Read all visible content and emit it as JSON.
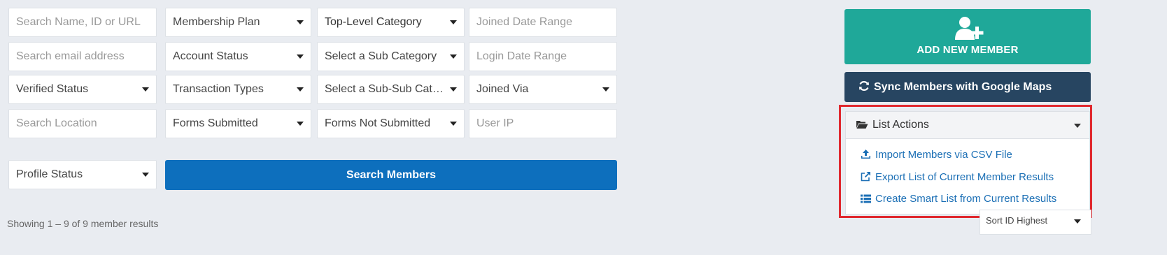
{
  "filters": {
    "search_name": "Search Name, ID or URL",
    "membership_plan": "Membership Plan",
    "top_category": "Top-Level Category",
    "joined_date_range": "Joined Date Range",
    "search_email": "Search email address",
    "account_status": "Account Status",
    "sub_category": "Select a Sub Category",
    "login_date_range": "Login Date Range",
    "verified_status": "Verified Status",
    "transaction_types": "Transaction Types",
    "sub_sub_category": "Select a Sub-Sub Category",
    "joined_via": "Joined Via",
    "search_location": "Search Location",
    "forms_submitted": "Forms Submitted",
    "forms_not_submitted": "Forms Not Submitted",
    "user_ip": "User IP",
    "profile_status": "Profile Status"
  },
  "search_button": "Search Members",
  "results_count": "Showing 1 – 9 of 9 member results",
  "add_member": {
    "label": "ADD NEW MEMBER",
    "icon": "user-plus-icon"
  },
  "sync_button": {
    "label": "Sync Members with Google Maps",
    "icon": "refresh-icon"
  },
  "list_actions": {
    "label": "List Actions",
    "icon": "folder-open-icon",
    "items": [
      {
        "label": "Import Members via CSV File",
        "icon": "upload-icon"
      },
      {
        "label": "Export List of Current Member Results",
        "icon": "external-link-icon"
      },
      {
        "label": "Create Smart List from Current Results",
        "icon": "list-icon"
      }
    ]
  },
  "sort": {
    "selected": "Sort ID Highest"
  },
  "colors": {
    "background": "#e9ecf1",
    "primary_blue": "#0d6fbd",
    "teal": "#1fa899",
    "navy": "#274561",
    "link_blue": "#1b6fb5",
    "highlight_red": "#e0282e"
  }
}
